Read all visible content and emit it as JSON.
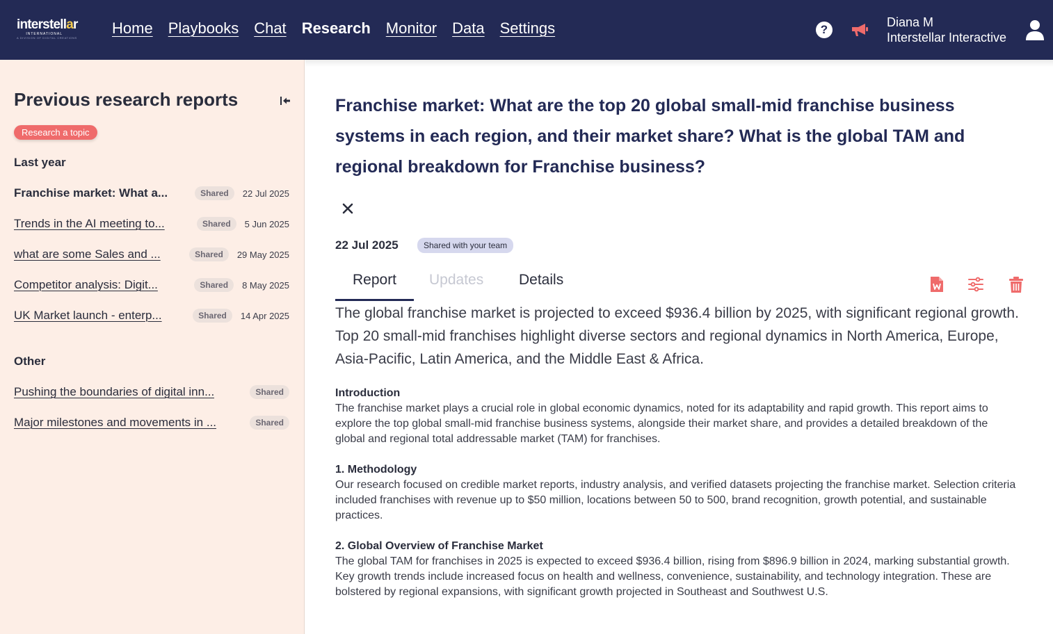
{
  "logo": {
    "word_start": "interstell",
    "word_accent": "a",
    "word_end": "r",
    "sub1": "INTERNATIONAL",
    "sub2": "A DIVISION OF DIGITAL CREATIONS"
  },
  "nav": [
    {
      "label": "Home",
      "active": false
    },
    {
      "label": "Playbooks",
      "active": false
    },
    {
      "label": "Chat",
      "active": false
    },
    {
      "label": "Research",
      "active": true
    },
    {
      "label": "Monitor",
      "active": false
    },
    {
      "label": "Data",
      "active": false
    },
    {
      "label": "Settings",
      "active": false
    }
  ],
  "header": {
    "help_glyph": "?",
    "user_name": "Diana M",
    "user_org": "Interstellar Interactive"
  },
  "icons": {
    "help": "help-icon",
    "announce": "megaphone-icon",
    "user": "user-icon",
    "collapse": "collapse-sidebar-icon",
    "close": "close-icon",
    "export": "word-document-icon",
    "settings": "sliders-icon",
    "delete": "trash-icon"
  },
  "colors": {
    "nav_bg": "#232a55",
    "sidebar_bg": "#fdeee6",
    "accent": "#ef6b6b",
    "logo_accent": "#f2c94c"
  },
  "sidebar": {
    "title": "Previous research reports",
    "research_button": "Research a topic",
    "groups": [
      {
        "label": "Last year",
        "items": [
          {
            "title": "Franchise market: What a...",
            "badge": "Shared",
            "date": "22 Jul 2025",
            "selected": true
          },
          {
            "title": "Trends in the AI meeting to...",
            "badge": "Shared",
            "date": "5 Jun 2025"
          },
          {
            "title": "what are some Sales and ...",
            "badge": "Shared",
            "date": "29 May 2025"
          },
          {
            "title": "Competitor analysis: Digit...",
            "badge": "Shared",
            "date": "8 May 2025"
          },
          {
            "title": "UK Market launch - enterp...",
            "badge": "Shared",
            "date": "14 Apr 2025"
          }
        ]
      },
      {
        "label": "Other",
        "items": [
          {
            "title": "Pushing the boundaries of digital inn...",
            "badge": "Shared"
          },
          {
            "title": "Major milestones and movements in ...",
            "badge": "Shared"
          }
        ]
      }
    ]
  },
  "report": {
    "title": "Franchise market: What are the top 20 global small-mid franchise business systems in each region, and their market share? What is the global TAM and regional breakdown for Franchise business?",
    "date": "22 Jul 2025",
    "share_badge": "Shared with your team",
    "tabs": [
      {
        "label": "Report",
        "state": "active"
      },
      {
        "label": "Updates",
        "state": "disabled"
      },
      {
        "label": "Details",
        "state": "normal"
      }
    ],
    "summary": "The global franchise market is projected to exceed $936.4 billion by 2025, with significant regional growth. Top 20 small-mid franchises highlight diverse sectors and regional dynamics in North America, Europe, Asia-Pacific, Latin America, and the Middle East & Africa.",
    "sections": [
      {
        "heading": "Introduction",
        "body": "The franchise market plays a crucial role in global economic dynamics, noted for its adaptability and rapid growth. This report aims to explore the top global small-mid franchise business systems, alongside their market share, and provides a detailed breakdown of the global and regional total addressable market (TAM) for franchises."
      },
      {
        "heading": "1. Methodology",
        "body": "Our research focused on credible market reports, industry analysis, and verified datasets projecting the franchise market. Selection criteria included franchises with revenue up to $50 million, locations between 50 to 500, brand recognition, growth potential, and sustainable practices."
      },
      {
        "heading": "2. Global Overview of Franchise Market",
        "body": "The global TAM for franchises in 2025 is expected to exceed $936.4 billion, rising from $896.9 billion in 2024, marking substantial growth. Key growth trends include increased focus on health and wellness, convenience, sustainability, and technology integration. These are bolstered by regional expansions, with significant growth projected in Southeast and Southwest U.S."
      }
    ]
  }
}
